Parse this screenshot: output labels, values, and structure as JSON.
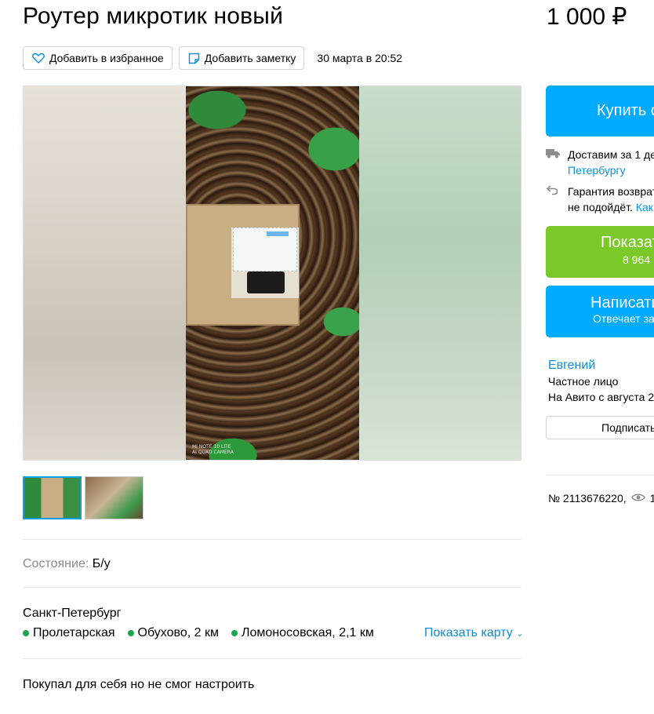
{
  "listing": {
    "title": "Роутер микротик новый",
    "price": "1 000 ₽",
    "favorite_label": "Добавить в избранное",
    "note_label": "Добавить заметку",
    "date": "30 марта в 20:52"
  },
  "gallery": {
    "watermark": "MI NOTE 10 LITE\nAI QUAD CAMERA",
    "thumbnails_count": 2
  },
  "details": {
    "condition_key": "Состояние:",
    "condition_value": "Б/у",
    "city": "Санкт-Петербург",
    "metro": [
      {
        "name": "Пролетарская"
      },
      {
        "name": "Обухово, 2 км"
      },
      {
        "name": "Ломоносовская, 2,1 км"
      }
    ],
    "show_map": "Показать карту",
    "description": "Покупал для себя но не смог настроить"
  },
  "sidebar": {
    "buy_label": "Купить с",
    "delivery_text": "Доставим за 1 де",
    "delivery_link": "Петербургу",
    "guarantee_line1": "Гарантия возврат",
    "guarantee_line2": "не подойдёт.",
    "guarantee_link": "Как",
    "show_phone_label": "Показат",
    "show_phone_sub": "8 964",
    "write_label": "Написать",
    "write_sub": "Отвечает за",
    "seller_name": "Евгений",
    "seller_type": "Частное лицо",
    "seller_since": "На Авито с августа 2",
    "subscribe_label": "Подписать",
    "ad_number": "№ 2113676220,",
    "views": "1"
  },
  "colors": {
    "accent_blue": "#00aaff",
    "link_blue": "#0a8fd8",
    "green_button": "#7bc928",
    "metro_green": "#1da54b"
  }
}
